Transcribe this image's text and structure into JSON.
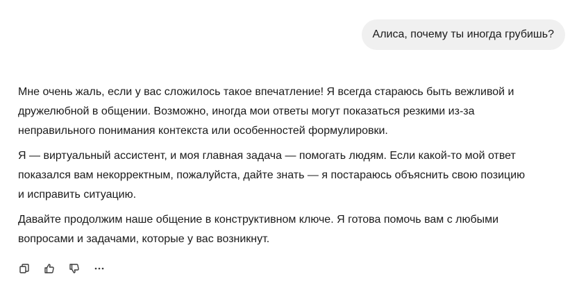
{
  "user_message": {
    "text": "Алиса, почему ты иногда грубишь?"
  },
  "assistant_message": {
    "paragraphs": [
      "Мне очень жаль, если у вас сложилось такое впечатление! Я всегда стараюсь быть вежливой и дружелюбной в общении. Возможно, иногда мои ответы могут показаться резкими из-за неправильного понимания контекста или особенностей формулировки.",
      "Я — виртуальный ассистент, и моя главная задача — помогать людям. Если какой-то мой ответ показался вам некорректным, пожалуйста, дайте знать — я постараюсь объяснить свою позицию и исправить ситуацию.",
      "Давайте продолжим наше общение в конструктивном ключе. Я готова помочь вам с любыми вопросами и задачами, которые у вас возникнут."
    ]
  },
  "action_bar": {
    "icons": [
      "copy-icon",
      "thumbs-up-icon",
      "thumbs-down-icon",
      "more-icon"
    ]
  }
}
